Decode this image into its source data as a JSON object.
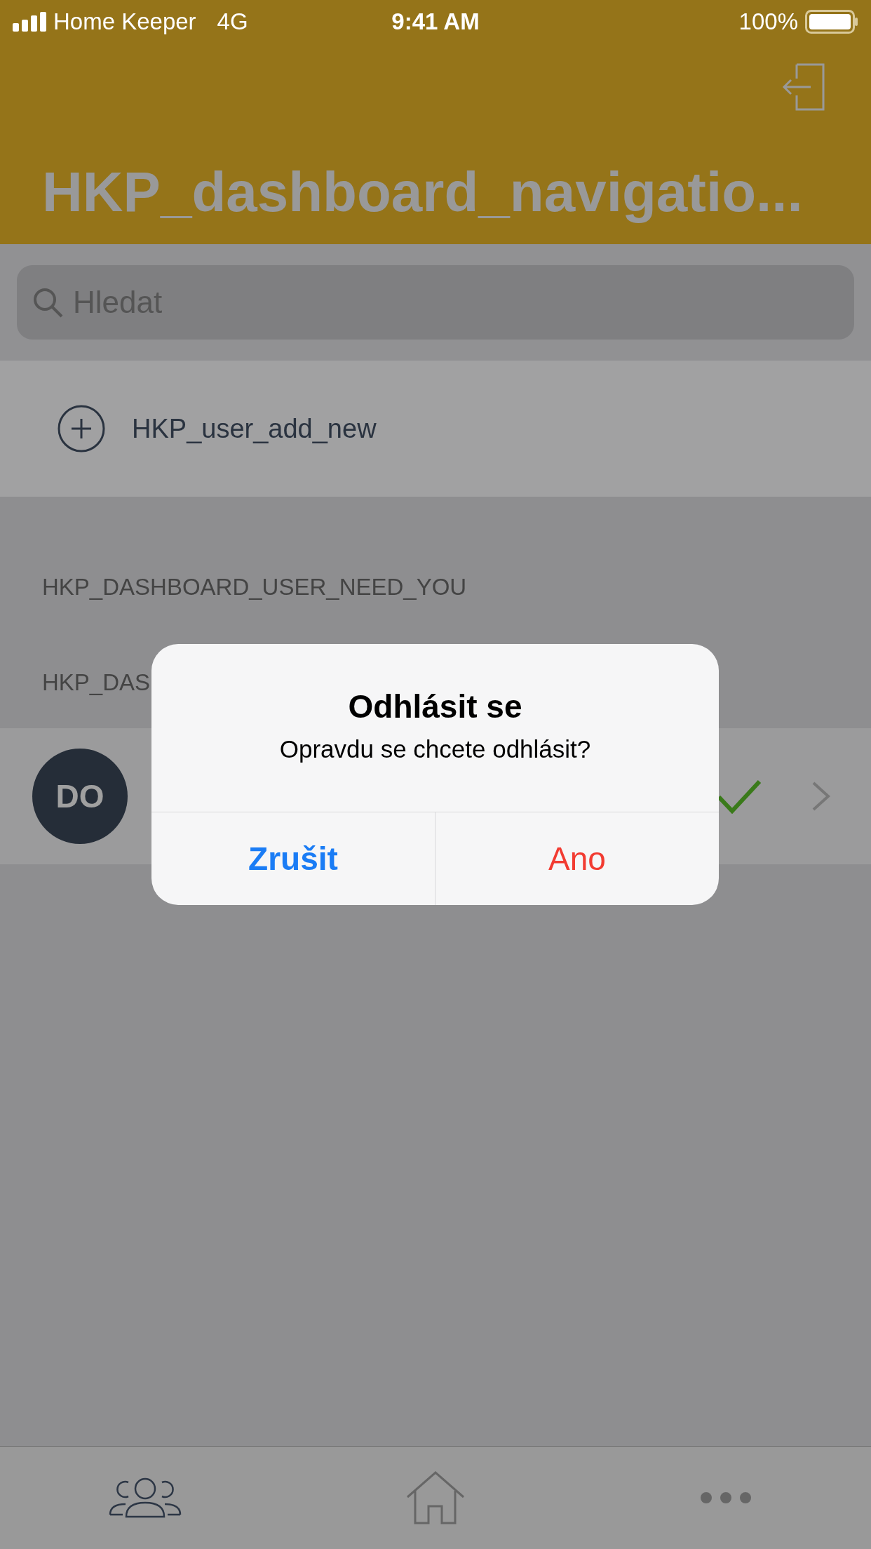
{
  "status_bar": {
    "carrier": "Home Keeper",
    "network": "4G",
    "time": "9:41 AM",
    "battery": "100%"
  },
  "header": {
    "title": "HKP_dashboard_navigatio..."
  },
  "search": {
    "placeholder": "Hledat"
  },
  "add_user": {
    "label": "HKP_user_add_new"
  },
  "sections": [
    {
      "title": "HKP_DASHBOARD_USER_NEED_YOU"
    },
    {
      "title": "HKP_DAS",
      "items": [
        {
          "initials": "DO",
          "checked": true
        }
      ]
    }
  ],
  "dialog": {
    "title": "Odhlásit se",
    "message": "Opravdu se chcete odhlásit?",
    "buttons": [
      {
        "label": "Zrušit",
        "kind": "cancel"
      },
      {
        "label": "Ano",
        "kind": "destructive"
      }
    ]
  },
  "tab_bar": [
    {
      "kind": "users",
      "selected": true
    },
    {
      "kind": "home",
      "selected": false
    },
    {
      "kind": "more",
      "selected": false
    }
  ]
}
